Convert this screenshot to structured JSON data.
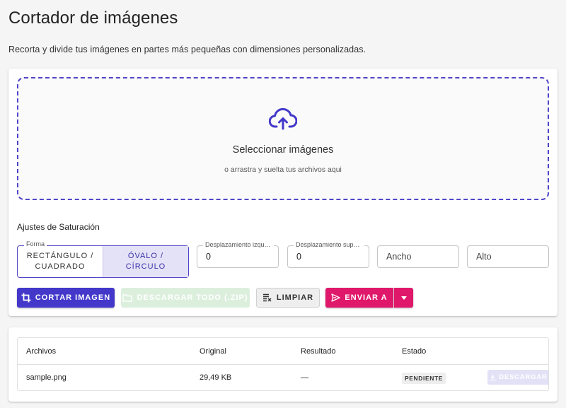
{
  "page": {
    "title": "Cortador de imágenes",
    "subtitle": "Recorta y divide tus imágenes en partes más pequeñas con dimensiones personalizadas."
  },
  "dropzone": {
    "title": "Seleccionar imágenes",
    "subtitle": "o arrastra y suelta tus archivos aqui",
    "icon": "cloud-upload-icon"
  },
  "settings": {
    "label": "Ajustes de Saturación",
    "shape": {
      "legend": "Forma",
      "options": [
        "RECTÁNGULO /\nCUADRADO",
        "ÓVALO /\nCÍRCULO"
      ],
      "selected": "ÓVALO /\nCÍRCULO"
    },
    "offset_x": {
      "legend": "Desplazamiento izquierdo",
      "value": "0"
    },
    "offset_y": {
      "legend": "Desplazamiento superior",
      "value": "0"
    },
    "width": {
      "placeholder": "Ancho"
    },
    "height": {
      "placeholder": "Alto"
    }
  },
  "actions": {
    "crop": "CORTAR IMAGEN",
    "download_all": "DESCARGAR TODO (.ZIP)",
    "clear": "LIMPIAR",
    "send": "ENVIAR A"
  },
  "table": {
    "headers": [
      "Archivos",
      "Original",
      "Resultado",
      "Estado"
    ],
    "rows": [
      {
        "file": "sample.png",
        "original": "29,49 KB",
        "result": "—",
        "status": "PENDIENTE",
        "action": "DESCARGAR"
      }
    ]
  },
  "colors": {
    "primary": "#4338ca",
    "accent": "#e0186b",
    "success_disabled": "#dcefdd"
  }
}
